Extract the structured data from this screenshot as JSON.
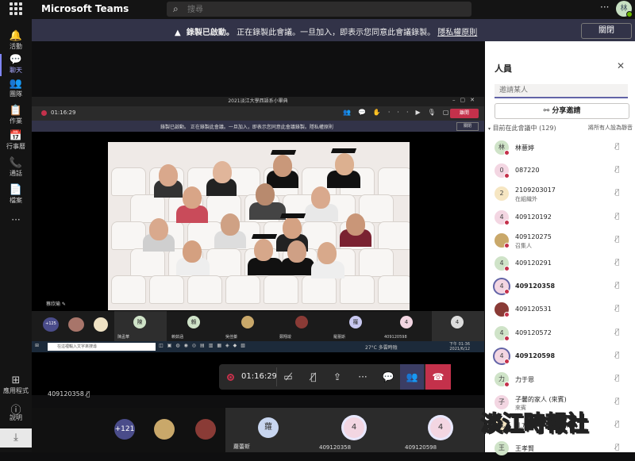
{
  "app": {
    "title": "Microsoft Teams",
    "search_placeholder": "搜尋",
    "avatar_initial": "林"
  },
  "rail": [
    {
      "label": "活動",
      "icon": "bell-icon",
      "glyph": "🔔"
    },
    {
      "label": "聊天",
      "icon": "chat-icon",
      "glyph": "💬"
    },
    {
      "label": "團隊",
      "icon": "teams-icon",
      "glyph": "👥"
    },
    {
      "label": "作業",
      "icon": "assignments-icon",
      "glyph": "📋"
    },
    {
      "label": "行事曆",
      "icon": "calendar-icon",
      "glyph": "📅"
    },
    {
      "label": "通話",
      "icon": "phone-icon",
      "glyph": "📞"
    },
    {
      "label": "檔案",
      "icon": "files-icon",
      "glyph": "📄"
    },
    {
      "label": "應用程式",
      "icon": "apps-icon",
      "glyph": "⊞"
    },
    {
      "label": "說明",
      "icon": "help-icon",
      "glyph": "?"
    }
  ],
  "banner": {
    "title": "錄製已啟動。",
    "text": "正在錄製此會議。一旦加入，即表示您同意此會議錄製。",
    "link": "隱私權原則",
    "close": "關閉"
  },
  "inner": {
    "title": "2021淡江大學西語系小畢典",
    "time": "01:16:29",
    "leave": "離開",
    "banner_text": "錄製已啟動。 正在錄製此會議。一旦加入，即表示您同意此會議錄製。隱私權原則",
    "banner_close": "關閉",
    "rec_name": "蔡欣瑜",
    "taskbar_search": "在這裡輸入文字來搜尋",
    "taskbar_tray": "27°C 多雲時陰",
    "taskbar_clock_time": "下午 01:36",
    "taskbar_clock_date": "2021/6/12",
    "thumb_count": "+125",
    "thumb_labels": [
      "陳孟華",
      "賴茹涵",
      "吳佳蓁",
      "鄭翔竣",
      "羅蕾斯",
      "409120598"
    ],
    "thumb_initials": [
      "陳",
      "賴",
      "羅",
      "4",
      "4"
    ]
  },
  "controls": {
    "time": "01:16:29"
  },
  "self": {
    "label": "409120358"
  },
  "gallery": {
    "count": "+121",
    "tiles": [
      {
        "name": "蘿蕾斯",
        "initial": "蘿"
      },
      {
        "name": "409120358",
        "initial": "4"
      },
      {
        "name": "409120598",
        "initial": "4"
      }
    ]
  },
  "panel": {
    "title": "人員",
    "invite_placeholder": "邀請某人",
    "share": "分享邀請",
    "section": "目前在此會議中 (129)",
    "mute_all": "將所有人設為靜音",
    "people": [
      {
        "initial": "林",
        "name": "林薏婷",
        "sub": ""
      },
      {
        "initial": "0",
        "name": "087220",
        "sub": ""
      },
      {
        "initial": "2",
        "name": "2109203017",
        "sub": "在組織外"
      },
      {
        "initial": "4",
        "name": "409120192",
        "sub": ""
      },
      {
        "initial": "",
        "name": "409120275",
        "sub": "召集人"
      },
      {
        "initial": "4",
        "name": "409120291",
        "sub": ""
      },
      {
        "initial": "4",
        "name": "409120358",
        "sub": ""
      },
      {
        "initial": "",
        "name": "409120531",
        "sub": ""
      },
      {
        "initial": "4",
        "name": "409120572",
        "sub": ""
      },
      {
        "initial": "4",
        "name": "409120598",
        "sub": ""
      },
      {
        "initial": "力",
        "name": "力于恩",
        "sub": ""
      },
      {
        "initial": "子",
        "name": "子馨的家人 (來賓)",
        "sub": "來賓"
      },
      {
        "initial": "孔",
        "name": "孔方朗",
        "sub": ""
      },
      {
        "initial": "王",
        "name": "王孝賢",
        "sub": ""
      }
    ]
  },
  "watermark": "淡江時報社"
}
